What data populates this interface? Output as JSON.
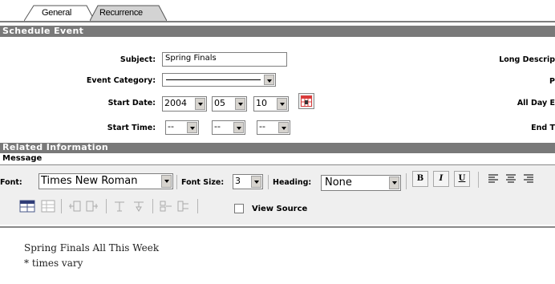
{
  "tabs": [
    {
      "label": "General",
      "active": true
    },
    {
      "label": "Recurrence",
      "active": false
    }
  ],
  "schedule_event": {
    "header": "Schedule Event",
    "subject_label": "Subject:",
    "subject_value": "Spring Finals",
    "category_label": "Event Category:",
    "category_value": "",
    "start_date_label": "Start Date:",
    "start_year": "2004",
    "start_month": "05",
    "start_day": "10",
    "start_time_label": "Start Time:",
    "start_hour": "--",
    "start_minute": "--",
    "start_ampm": "--",
    "right_labels": {
      "long_description": "Long Descrip",
      "second": "P",
      "all_day": "All Day E",
      "end_time": "End T"
    }
  },
  "related": {
    "header": "Related Information",
    "message_label": "Message"
  },
  "toolbar": {
    "font_label": "Font:",
    "font_value": "Times New Roman",
    "font_size_label": "Font Size:",
    "font_size_value": "3",
    "heading_label": "Heading:",
    "heading_value": "None",
    "bold": "B",
    "italic": "I",
    "underline": "U",
    "view_source_label": "View Source",
    "view_source_checked": false
  },
  "editor": {
    "line1": "Spring Finals All This Week",
    "line2": "* times vary"
  }
}
